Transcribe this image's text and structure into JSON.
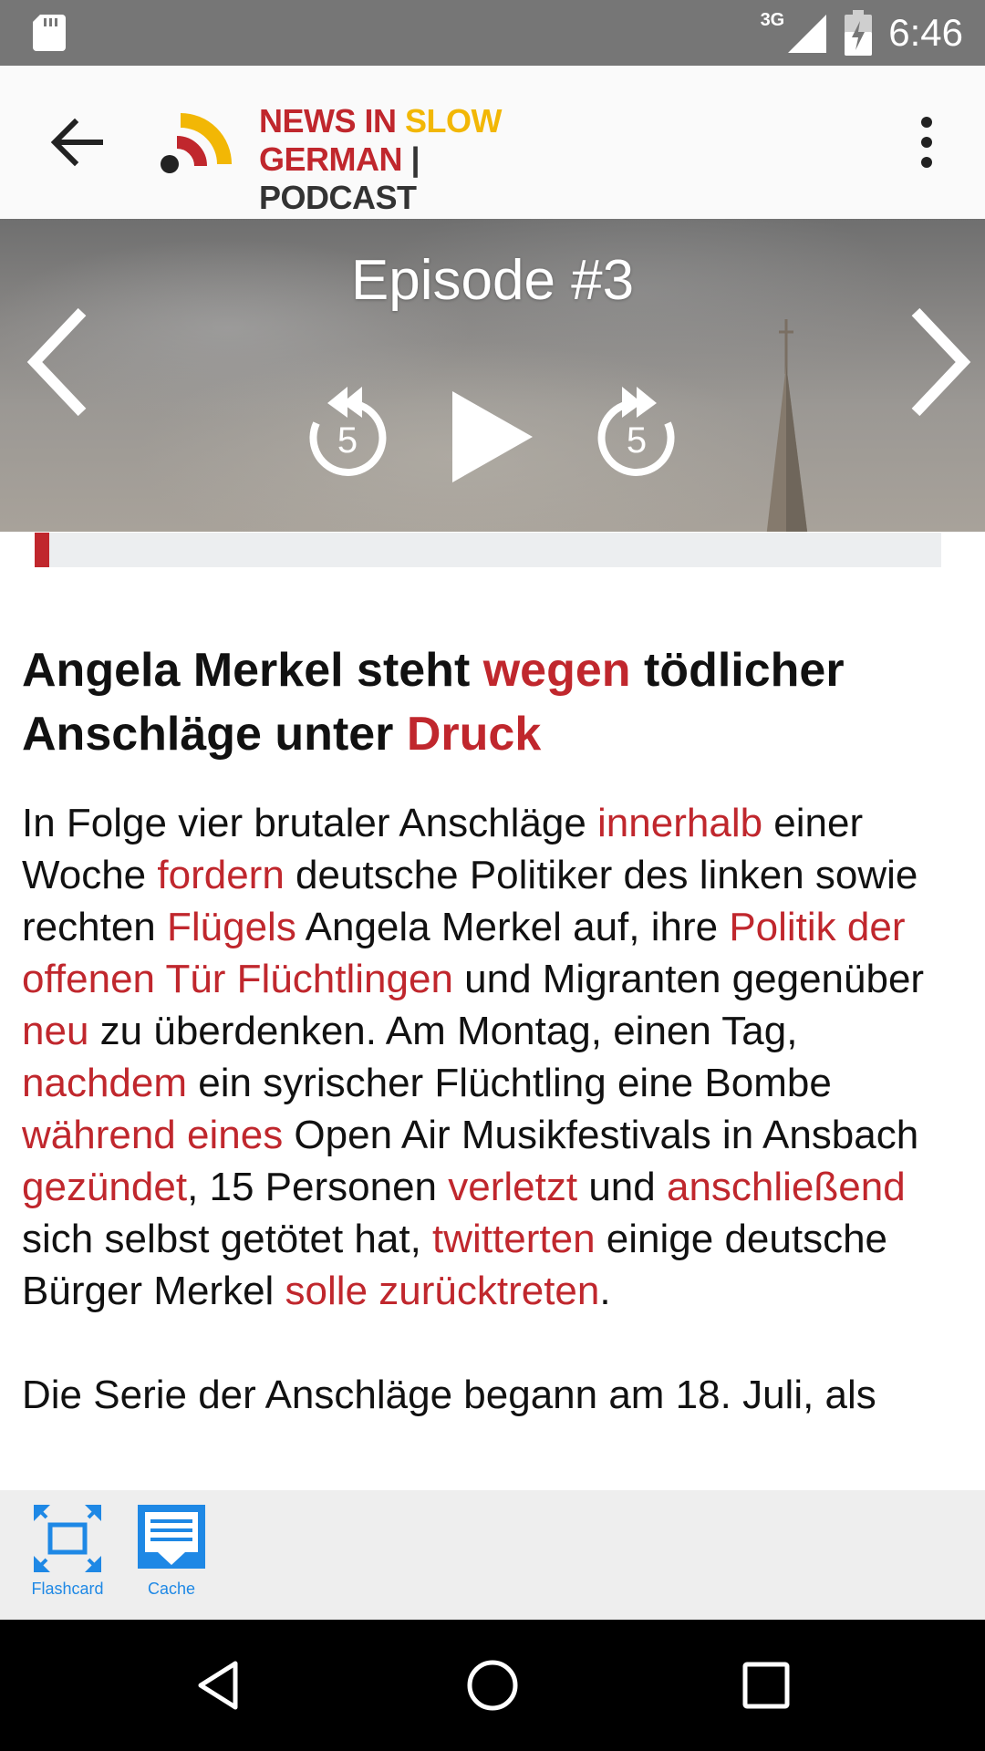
{
  "status_bar": {
    "network": "3G",
    "time": "6:46"
  },
  "app_bar": {
    "logo": {
      "line1_a": "NEWS IN ",
      "line1_b": "SLOW",
      "line2_a": "GERMAN",
      "line2_b": " | PODCAST"
    }
  },
  "player": {
    "episode_title": "Episode #3",
    "rewind_seconds": "5",
    "forward_seconds": "5",
    "progress_fraction": 0.016
  },
  "article": {
    "headline": [
      {
        "t": "Angela Merkel steht ",
        "h": false
      },
      {
        "t": "wegen",
        "h": true
      },
      {
        "t": " tödlicher Anschläge unter ",
        "h": false
      },
      {
        "t": "Druck",
        "h": true
      }
    ],
    "paragraphs": [
      [
        {
          "t": "In Folge vier brutaler Anschläge ",
          "h": false
        },
        {
          "t": "innerhalb",
          "h": true
        },
        {
          "t": " einer Woche ",
          "h": false
        },
        {
          "t": "fordern",
          "h": true
        },
        {
          "t": " deutsche Politiker des linken sowie rechten ",
          "h": false
        },
        {
          "t": "Flügels",
          "h": true
        },
        {
          "t": " Angela Merkel auf, ihre ",
          "h": false
        },
        {
          "t": "Politik der offenen Tür Flüchtlingen",
          "h": true
        },
        {
          "t": " und Migranten gegenüber ",
          "h": false
        },
        {
          "t": "neu",
          "h": true
        },
        {
          "t": " zu überdenken. Am Montag, einen Tag, ",
          "h": false
        },
        {
          "t": "nachdem",
          "h": true
        },
        {
          "t": " ein syrischer Flüchtling eine Bombe ",
          "h": false
        },
        {
          "t": "während eines",
          "h": true
        },
        {
          "t": " Open Air Musikfestivals in Ansbach ",
          "h": false
        },
        {
          "t": "gezündet",
          "h": true
        },
        {
          "t": ", 15 Personen ",
          "h": false
        },
        {
          "t": "verletzt",
          "h": true
        },
        {
          "t": " und ",
          "h": false
        },
        {
          "t": "anschließend",
          "h": true
        },
        {
          "t": " sich selbst getötet hat, ",
          "h": false
        },
        {
          "t": "twitterten",
          "h": true
        },
        {
          "t": " einige deutsche Bürger Merkel ",
          "h": false
        },
        {
          "t": "solle zurücktreten",
          "h": true
        },
        {
          "t": ".",
          "h": false
        }
      ],
      [
        {
          "t": "Die Serie der Anschläge begann am 18. Juli, als",
          "h": false
        }
      ]
    ]
  },
  "toolbar": {
    "flashcard_label": "Flashcard",
    "cache_label": "Cache"
  },
  "colors": {
    "accent_red": "#c0272d",
    "accent_yellow": "#f2b705",
    "tool_blue": "#1e88e5"
  }
}
